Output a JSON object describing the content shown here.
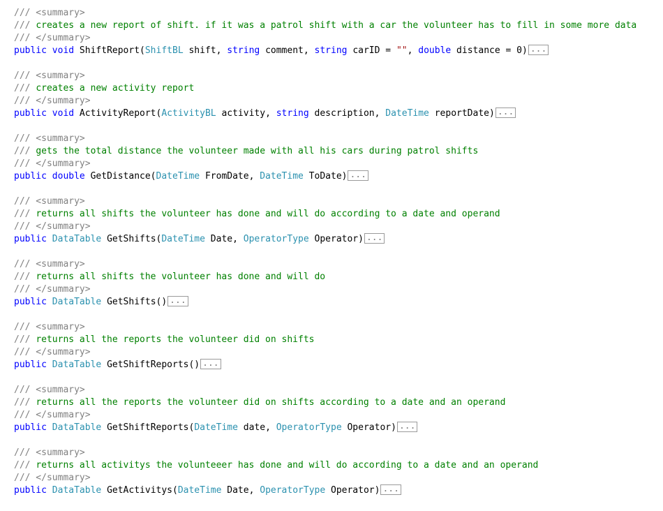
{
  "colors": {
    "background": "#ffffff",
    "comment_marker": "#808080",
    "comment_text": "#008000",
    "keyword": "#0000ff",
    "type": "#2b91af",
    "identifier": "#000000",
    "string": "#a31515",
    "collapse_box_border": "#9a9a9a"
  },
  "editor": {
    "lines": [
      [
        {
          "c": "cmt-mark",
          "t": "/// <summary>"
        }
      ],
      [
        {
          "c": "cmt-mark",
          "t": "/// "
        },
        {
          "c": "cmt-text",
          "t": "creates a new report of shift. if it was a patrol shift with a car the volunteer has to fill in some more data"
        }
      ],
      [
        {
          "c": "cmt-mark",
          "t": "/// </summary>"
        }
      ],
      [
        {
          "c": "keyword",
          "t": "public"
        },
        {
          "c": "plain",
          "t": " "
        },
        {
          "c": "keyword",
          "t": "void"
        },
        {
          "c": "plain",
          "t": " ShiftReport("
        },
        {
          "c": "type",
          "t": "ShiftBL"
        },
        {
          "c": "plain",
          "t": " shift, "
        },
        {
          "c": "keyword",
          "t": "string"
        },
        {
          "c": "plain",
          "t": " comment, "
        },
        {
          "c": "keyword",
          "t": "string"
        },
        {
          "c": "plain",
          "t": " carID = "
        },
        {
          "c": "string",
          "t": "\"\""
        },
        {
          "c": "plain",
          "t": ", "
        },
        {
          "c": "keyword",
          "t": "double"
        },
        {
          "c": "plain",
          "t": " distance = 0)"
        },
        {
          "c": "collapse",
          "t": "..."
        }
      ],
      [],
      [
        {
          "c": "cmt-mark",
          "t": "/// <summary>"
        }
      ],
      [
        {
          "c": "cmt-mark",
          "t": "/// "
        },
        {
          "c": "cmt-text",
          "t": "creates a new activity report"
        }
      ],
      [
        {
          "c": "cmt-mark",
          "t": "/// </summary>"
        }
      ],
      [
        {
          "c": "keyword",
          "t": "public"
        },
        {
          "c": "plain",
          "t": " "
        },
        {
          "c": "keyword",
          "t": "void"
        },
        {
          "c": "plain",
          "t": " ActivityReport("
        },
        {
          "c": "type",
          "t": "ActivityBL"
        },
        {
          "c": "plain",
          "t": " activity, "
        },
        {
          "c": "keyword",
          "t": "string"
        },
        {
          "c": "plain",
          "t": " description, "
        },
        {
          "c": "type",
          "t": "DateTime"
        },
        {
          "c": "plain",
          "t": " reportDate)"
        },
        {
          "c": "collapse",
          "t": "..."
        }
      ],
      [],
      [
        {
          "c": "cmt-mark",
          "t": "/// <summary>"
        }
      ],
      [
        {
          "c": "cmt-mark",
          "t": "/// "
        },
        {
          "c": "cmt-text",
          "t": "gets the total distance the volunteer made with all his cars during patrol shifts"
        }
      ],
      [
        {
          "c": "cmt-mark",
          "t": "/// </summary>"
        }
      ],
      [
        {
          "c": "keyword",
          "t": "public"
        },
        {
          "c": "plain",
          "t": " "
        },
        {
          "c": "keyword",
          "t": "double"
        },
        {
          "c": "plain",
          "t": " GetDistance("
        },
        {
          "c": "type",
          "t": "DateTime"
        },
        {
          "c": "plain",
          "t": " FromDate, "
        },
        {
          "c": "type",
          "t": "DateTime"
        },
        {
          "c": "plain",
          "t": " ToDate)"
        },
        {
          "c": "collapse",
          "t": "..."
        }
      ],
      [],
      [
        {
          "c": "cmt-mark",
          "t": "/// <summary>"
        }
      ],
      [
        {
          "c": "cmt-mark",
          "t": "/// "
        },
        {
          "c": "cmt-text",
          "t": "returns all shifts the volunteer has done and will do according to a date and operand"
        }
      ],
      [
        {
          "c": "cmt-mark",
          "t": "/// </summary>"
        }
      ],
      [
        {
          "c": "keyword",
          "t": "public"
        },
        {
          "c": "plain",
          "t": " "
        },
        {
          "c": "type",
          "t": "DataTable"
        },
        {
          "c": "plain",
          "t": " GetShifts("
        },
        {
          "c": "type",
          "t": "DateTime"
        },
        {
          "c": "plain",
          "t": " Date, "
        },
        {
          "c": "type",
          "t": "OperatorType"
        },
        {
          "c": "plain",
          "t": " Operator)"
        },
        {
          "c": "collapse",
          "t": "..."
        }
      ],
      [],
      [
        {
          "c": "cmt-mark",
          "t": "/// <summary>"
        }
      ],
      [
        {
          "c": "cmt-mark",
          "t": "/// "
        },
        {
          "c": "cmt-text",
          "t": "returns all shifts the volunteer has done and will do"
        }
      ],
      [
        {
          "c": "cmt-mark",
          "t": "/// </summary>"
        }
      ],
      [
        {
          "c": "keyword",
          "t": "public"
        },
        {
          "c": "plain",
          "t": " "
        },
        {
          "c": "type",
          "t": "DataTable"
        },
        {
          "c": "plain",
          "t": " GetShifts()"
        },
        {
          "c": "collapse",
          "t": "..."
        }
      ],
      [],
      [
        {
          "c": "cmt-mark",
          "t": "/// <summary>"
        }
      ],
      [
        {
          "c": "cmt-mark",
          "t": "/// "
        },
        {
          "c": "cmt-text",
          "t": "returns all the reports the volunteer did on shifts"
        }
      ],
      [
        {
          "c": "cmt-mark",
          "t": "/// </summary>"
        }
      ],
      [
        {
          "c": "keyword",
          "t": "public"
        },
        {
          "c": "plain",
          "t": " "
        },
        {
          "c": "type",
          "t": "DataTable"
        },
        {
          "c": "plain",
          "t": " GetShiftReports()"
        },
        {
          "c": "collapse",
          "t": "..."
        }
      ],
      [],
      [
        {
          "c": "cmt-mark",
          "t": "/// <summary>"
        }
      ],
      [
        {
          "c": "cmt-mark",
          "t": "/// "
        },
        {
          "c": "cmt-text",
          "t": "returns all the reports the volunteer did on shifts according to a date and an operand"
        }
      ],
      [
        {
          "c": "cmt-mark",
          "t": "/// </summary>"
        }
      ],
      [
        {
          "c": "keyword",
          "t": "public"
        },
        {
          "c": "plain",
          "t": " "
        },
        {
          "c": "type",
          "t": "DataTable"
        },
        {
          "c": "plain",
          "t": " GetShiftReports("
        },
        {
          "c": "type",
          "t": "DateTime"
        },
        {
          "c": "plain",
          "t": " date, "
        },
        {
          "c": "type",
          "t": "OperatorType"
        },
        {
          "c": "plain",
          "t": " Operator)"
        },
        {
          "c": "collapse",
          "t": "..."
        }
      ],
      [],
      [
        {
          "c": "cmt-mark",
          "t": "/// <summary>"
        }
      ],
      [
        {
          "c": "cmt-mark",
          "t": "/// "
        },
        {
          "c": "cmt-text",
          "t": "returns all activitys the volunteeer has done and will do according to a date and an operand"
        }
      ],
      [
        {
          "c": "cmt-mark",
          "t": "/// </summary>"
        }
      ],
      [
        {
          "c": "keyword",
          "t": "public"
        },
        {
          "c": "plain",
          "t": " "
        },
        {
          "c": "type",
          "t": "DataTable"
        },
        {
          "c": "plain",
          "t": " GetActivitys("
        },
        {
          "c": "type",
          "t": "DateTime"
        },
        {
          "c": "plain",
          "t": " Date, "
        },
        {
          "c": "type",
          "t": "OperatorType"
        },
        {
          "c": "plain",
          "t": " Operator)"
        },
        {
          "c": "collapse",
          "t": "..."
        }
      ]
    ]
  }
}
